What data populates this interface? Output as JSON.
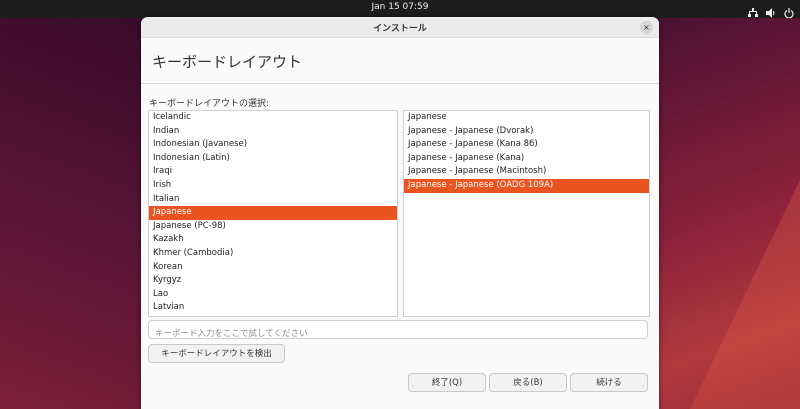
{
  "topbar": {
    "clock": "Jan 15  07:59",
    "icons": [
      "network-icon",
      "volume-icon",
      "power-icon"
    ]
  },
  "window": {
    "title": "インストール",
    "close_glyph": "×"
  },
  "page": {
    "heading": "キーボードレイアウト",
    "section_label": "キーボードレイアウトの選択:"
  },
  "layouts": {
    "selected": "Japanese",
    "items": [
      "Icelandic",
      "Indian",
      "Indonesian (Javanese)",
      "Indonesian (Latin)",
      "Iraqi",
      "Irish",
      "Italian",
      "Japanese",
      "Japanese (PC-98)",
      "Kazakh",
      "Khmer (Cambodia)",
      "Korean",
      "Kyrgyz",
      "Lao",
      "Latvian"
    ]
  },
  "variants": {
    "selected": "Japanese - Japanese (OADG 109A)",
    "items": [
      "Japanese",
      "Japanese - Japanese (Dvorak)",
      "Japanese - Japanese (Kana 86)",
      "Japanese - Japanese (Kana)",
      "Japanese - Japanese (Macintosh)",
      "Japanese - Japanese (OADG 109A)"
    ]
  },
  "test_input": {
    "placeholder": "キーボード入力をここで試してください",
    "value": ""
  },
  "buttons": {
    "detect": "キーボードレイアウトを検出",
    "quit": "終了(Q)",
    "back": "戻る(B)",
    "continue": "続ける"
  },
  "colors": {
    "accent": "#e95420"
  }
}
